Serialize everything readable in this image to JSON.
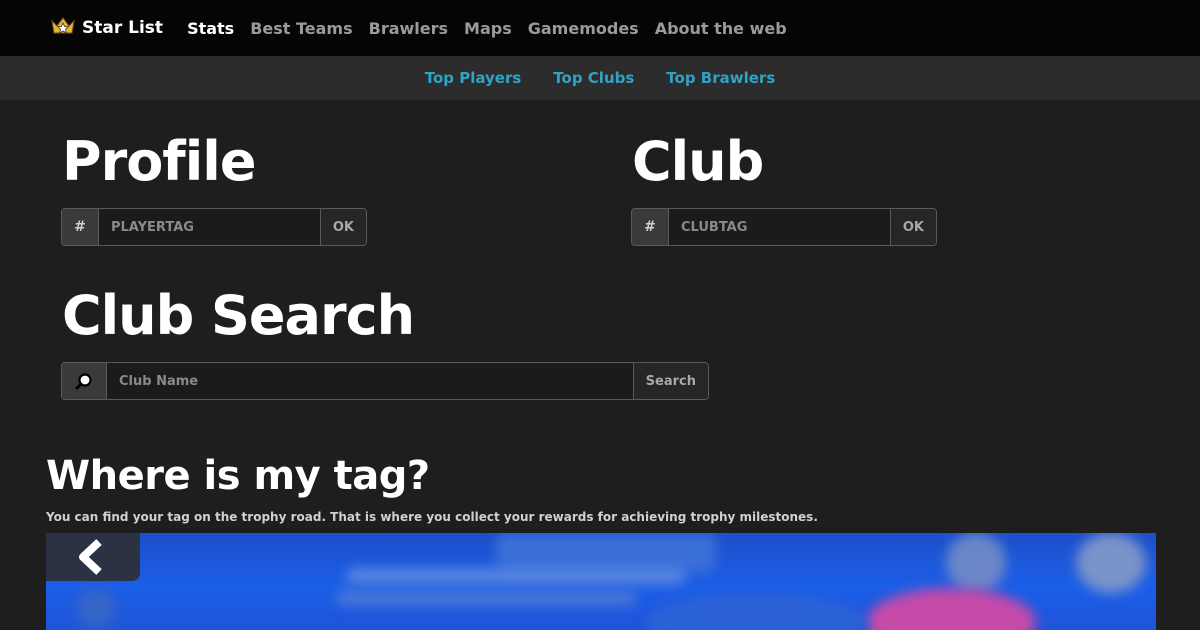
{
  "brand": {
    "name": "Star List",
    "icon": "star-crown-icon"
  },
  "nav": {
    "items": [
      {
        "label": "Stats",
        "active": true
      },
      {
        "label": "Best Teams",
        "active": false
      },
      {
        "label": "Brawlers",
        "active": false
      },
      {
        "label": "Maps",
        "active": false
      },
      {
        "label": "Gamemodes",
        "active": false
      },
      {
        "label": "About the web",
        "active": false
      }
    ]
  },
  "subnav": {
    "items": [
      "Top Players",
      "Top Clubs",
      "Top Brawlers"
    ],
    "color": "#2fa3c5"
  },
  "profile": {
    "title": "Profile",
    "prefix": "#",
    "placeholder": "PLAYERTAG",
    "button": "OK"
  },
  "club": {
    "title": "Club",
    "prefix": "#",
    "placeholder": "CLUBTAG",
    "button": "OK"
  },
  "club_search": {
    "title": "Club Search",
    "placeholder": "Club Name",
    "button": "Search",
    "icon": "search-icon"
  },
  "tag_help": {
    "title": "Where is my tag?",
    "text": "You can find your tag on the trophy road. That is where you collect your rewards for achieving trophy milestones."
  }
}
